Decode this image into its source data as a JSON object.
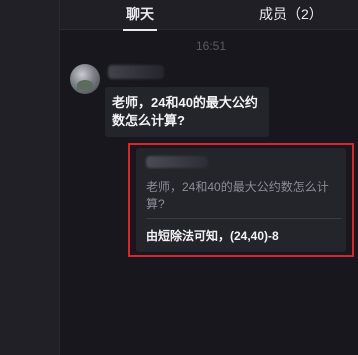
{
  "tabs": {
    "chat": "聊天",
    "members": "成员（2）"
  },
  "chat": {
    "timestamp": "16:51",
    "message": "老师，24和40的最大公约数怎么计算?"
  },
  "reply": {
    "quoted_text": "老师，24和40的最大公约数怎么计算?",
    "answer": "由短除法可知，(24,40)-8"
  },
  "colors": {
    "highlight_border": "#d8262e",
    "background": "#17171d",
    "bubble": "#24242b"
  },
  "icons": {
    "avatar": "user-avatar-photo"
  }
}
